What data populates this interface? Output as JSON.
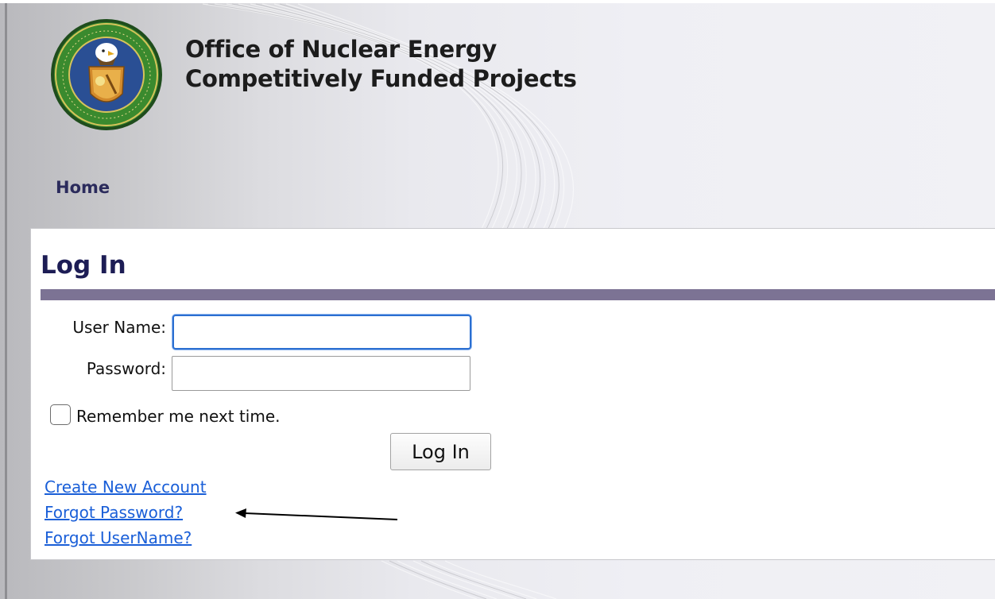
{
  "header": {
    "title_line1": "Office of Nuclear Energy",
    "title_line2": "Competitively Funded Projects",
    "logo": "department-of-energy-seal"
  },
  "nav": {
    "home_label": "Home"
  },
  "login": {
    "heading": "Log In",
    "username_label": "User Name:",
    "username_value": "",
    "password_label": "Password:",
    "password_value": "",
    "remember_label": "Remember me next time.",
    "remember_checked": false,
    "submit_label": "Log In"
  },
  "links": {
    "create_account": "Create New Account",
    "forgot_password": "Forgot Password?",
    "forgot_username": "Forgot UserName?"
  },
  "colors": {
    "heading_bar": "#7c7394",
    "heading_text": "#1d1d55",
    "link": "#1a5fd8",
    "focus_border": "#2b6fd1"
  }
}
